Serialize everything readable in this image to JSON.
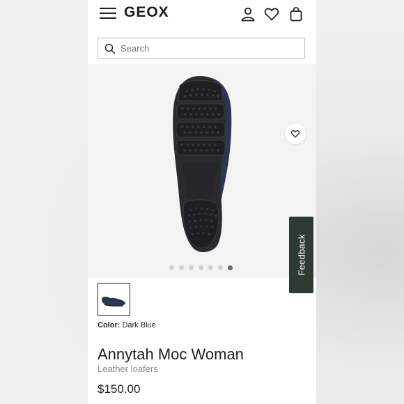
{
  "header": {
    "logo": "GEOX",
    "icons": [
      "hamburger-menu-icon",
      "account-icon",
      "wishlist-heart-icon",
      "shopping-bag-icon"
    ]
  },
  "search": {
    "placeholder": "Search",
    "value": ""
  },
  "gallery": {
    "image_count": 7,
    "active_index": 6
  },
  "product": {
    "color_label": "Color:",
    "color_value": "Dark Blue",
    "name": "Annytah Moc Woman",
    "category": "Leather loafers",
    "price": "$150.00"
  },
  "feedback": {
    "label": "Feedback"
  },
  "colors": {
    "feedback_bg": "#2f3a33",
    "gallery_bg": "#f3f3f3",
    "shoe_sole": "#2a2a2e",
    "shoe_upper": "#2e3550"
  }
}
